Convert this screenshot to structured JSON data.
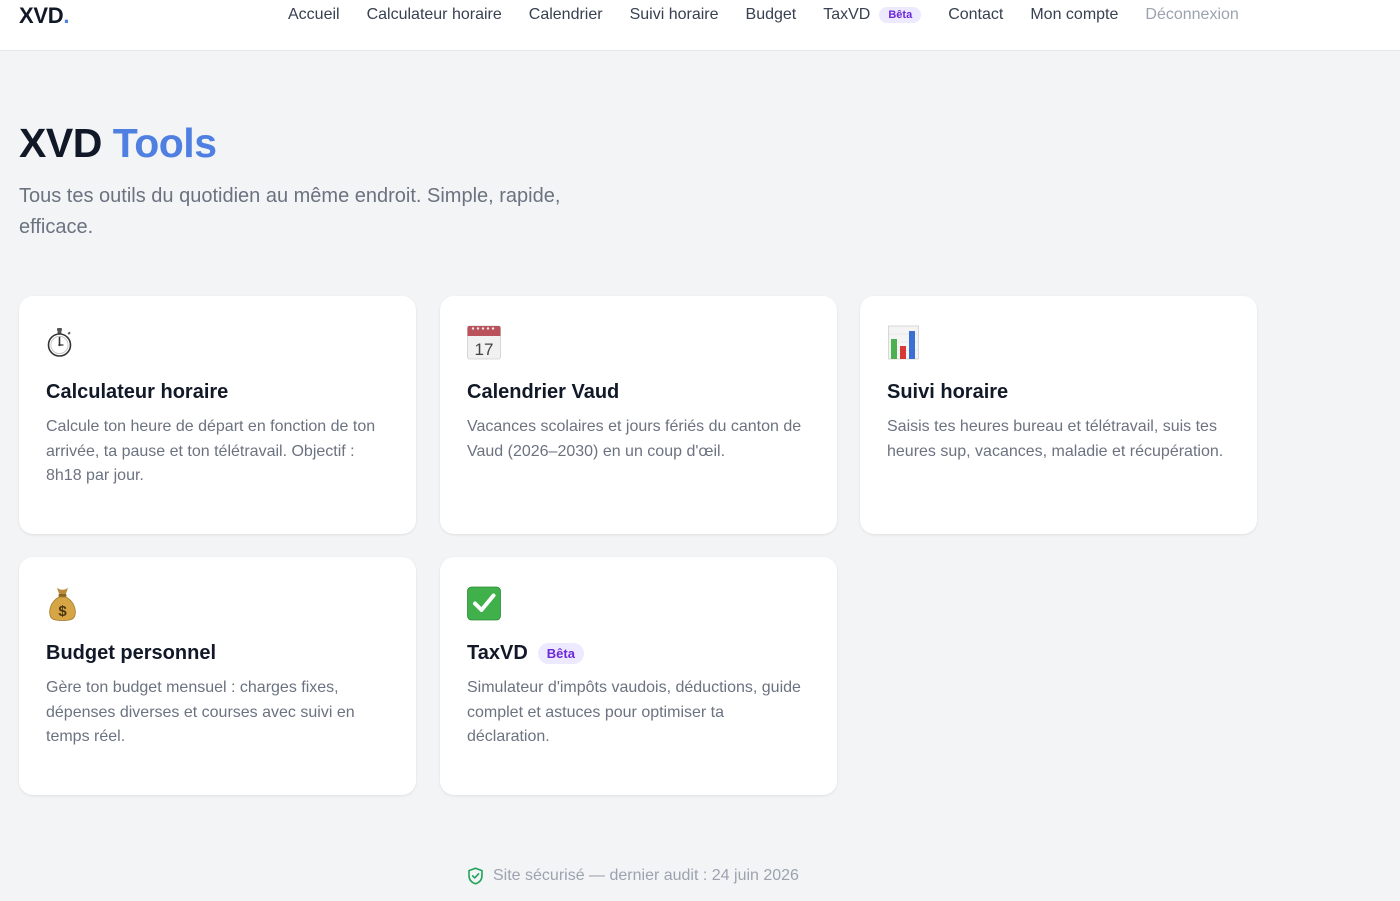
{
  "brand": {
    "name": "XVD",
    "dot": "."
  },
  "nav": {
    "items": [
      {
        "label": "Accueil"
      },
      {
        "label": "Calculateur horaire"
      },
      {
        "label": "Calendrier"
      },
      {
        "label": "Suivi horaire"
      },
      {
        "label": "Budget"
      },
      {
        "label": "TaxVD",
        "badge": "Bêta"
      },
      {
        "label": "Contact"
      },
      {
        "label": "Mon compte"
      },
      {
        "label": "Déconnexion"
      }
    ]
  },
  "hero": {
    "title_main": "XVD",
    "title_accent": "Tools",
    "subtitle": "Tous tes outils du quotidien au même endroit. Simple, rapide, efficace."
  },
  "cards": [
    {
      "icon": "stopwatch-icon",
      "title": "Calculateur horaire",
      "description": "Calcule ton heure de départ en fonction de ton arrivée, ta pause et ton télétravail. Objectif : 8h18 par jour."
    },
    {
      "icon": "calendar-icon",
      "title": "Calendrier Vaud",
      "description": "Vacances scolaires et jours fériés du canton de Vaud (2026–2030) en un coup d'œil.",
      "icon_text": "17"
    },
    {
      "icon": "bar-chart-icon",
      "title": "Suivi horaire",
      "description": "Saisis tes heures bureau et télétravail, suis tes heures sup, vacances, maladie et récupération."
    },
    {
      "icon": "money-bag-icon",
      "title": "Budget personnel",
      "description": "Gère ton budget mensuel : charges fixes, dépenses diverses et courses avec suivi en temps réel."
    },
    {
      "icon": "check-mark-icon",
      "title": "TaxVD",
      "badge": "Bêta",
      "description": "Simulateur d'impôts vaudois, déductions, guide complet et astuces pour optimiser ta déclaration."
    }
  ],
  "footer": {
    "text": "Site sécurisé — dernier audit : 24 juin 2026",
    "icon": "shield-check-icon"
  },
  "colors": {
    "accent": "#4f80e1",
    "badge_bg": "#ede9fe",
    "badge_text": "#6d28d9",
    "shield": "#22a35a",
    "background": "#f3f4f6"
  }
}
